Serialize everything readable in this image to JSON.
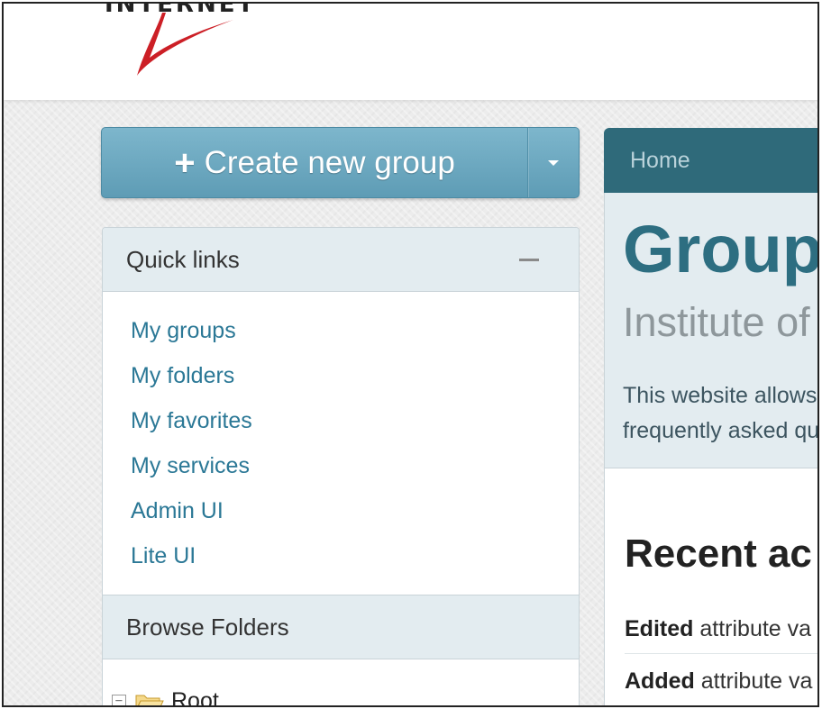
{
  "header": {
    "logo_text": "INTERNET",
    "logo_mark": "®"
  },
  "sidebar": {
    "create_button": {
      "icon": "plus-icon",
      "label": "Create new group",
      "dropdown_icon": "caret-down-icon"
    },
    "quick_links": {
      "title": "Quick links",
      "collapse_icon": "minus-icon",
      "items": [
        {
          "label": "My groups"
        },
        {
          "label": "My folders"
        },
        {
          "label": "My favorites"
        },
        {
          "label": "My services"
        },
        {
          "label": "Admin UI"
        },
        {
          "label": "Lite UI"
        }
      ]
    },
    "browse_folders": {
      "title": "Browse Folders",
      "tree": [
        {
          "label": "Root",
          "toggle": "−",
          "icon": "folder-open-icon"
        }
      ]
    }
  },
  "main": {
    "breadcrumb": "Home",
    "title": "Groupe",
    "subtitle": "Institute of",
    "description_lines": [
      "This website allows",
      "frequently asked qu"
    ],
    "recent": {
      "title": "Recent ac",
      "items": [
        {
          "action": "Edited",
          "text": "attribute va"
        },
        {
          "action": "Added",
          "text": "attribute va"
        }
      ]
    }
  },
  "colors": {
    "accent": "#2d6e81",
    "button": "#6aa8c0",
    "link": "#2b7896",
    "panel_header": "#e3ecf0",
    "logo_red": "#cc1f26"
  }
}
